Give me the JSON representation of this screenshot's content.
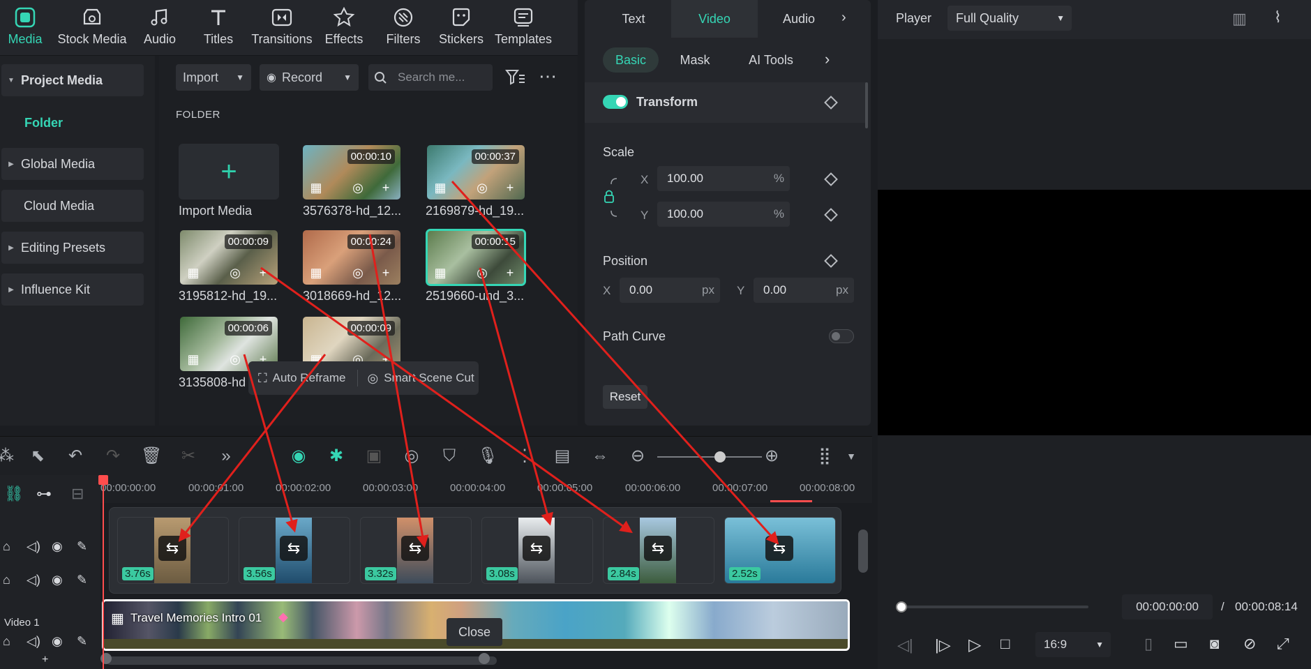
{
  "toolbar": {
    "items": [
      {
        "label": "Media",
        "icon": "media-icon"
      },
      {
        "label": "Stock Media",
        "icon": "stock-media-icon"
      },
      {
        "label": "Audio",
        "icon": "audio-icon"
      },
      {
        "label": "Titles",
        "icon": "titles-icon"
      },
      {
        "label": "Transitions",
        "icon": "transitions-icon"
      },
      {
        "label": "Effects",
        "icon": "effects-icon"
      },
      {
        "label": "Filters",
        "icon": "filters-icon"
      },
      {
        "label": "Stickers",
        "icon": "stickers-icon"
      },
      {
        "label": "Templates",
        "icon": "templates-icon"
      }
    ]
  },
  "sidebar": {
    "items": [
      "Project Media",
      "Global Media",
      "Cloud Media",
      "Editing Presets",
      "Influence Kit"
    ],
    "folder": "Folder"
  },
  "media": {
    "import_label": "Import",
    "record_label": "Record",
    "search_placeholder": "Search me...",
    "folder_header": "FOLDER",
    "import_media": "Import Media",
    "clips": [
      {
        "name": "3576378-hd_12...",
        "duration": "00:00:10"
      },
      {
        "name": "2169879-hd_19...",
        "duration": "00:00:37"
      },
      {
        "name": "3195812-hd_19...",
        "duration": "00:00:09"
      },
      {
        "name": "3018669-hd_12...",
        "duration": "00:00:24"
      },
      {
        "name": "2519660-uhd_3...",
        "duration": "00:00:15"
      },
      {
        "name": "3135808-hd",
        "duration": "00:00:06"
      },
      {
        "name": "",
        "duration": "00:00:09"
      }
    ],
    "popup": {
      "auto_reframe": "Auto Reframe",
      "smart_scene_cut": "Smart Scene Cut"
    }
  },
  "panel": {
    "tabs": [
      "Text",
      "Video",
      "Audio"
    ],
    "subtabs": [
      "Basic",
      "Mask",
      "AI Tools"
    ],
    "transform": "Transform",
    "scale": "Scale",
    "scale_x": "100.00",
    "scale_y": "100.00",
    "percent": "%",
    "position": "Position",
    "pos_x": "0.00",
    "pos_y": "0.00",
    "px": "px",
    "path_curve": "Path Curve",
    "reset": "Reset",
    "x_label": "X",
    "y_label": "Y"
  },
  "player": {
    "label": "Player",
    "quality": "Full Quality",
    "current_time": "00:00:00:00",
    "separator": "/",
    "total_time": "00:00:08:14",
    "aspect": "16:9"
  },
  "timeline": {
    "ticks": [
      "00:00:00:00",
      "00:00:01:00",
      "00:00:02:00",
      "00:00:03:00",
      "00:00:04:00",
      "00:00:05:00",
      "00:00:06:00",
      "00:00:07:00",
      "00:00:08:00"
    ],
    "clip_lengths": [
      "3.76s",
      "3.56s",
      "3.32s",
      "3.08s",
      "2.84s",
      "2.52s"
    ],
    "main_clip_title": "Travel Memories Intro 01",
    "track_label": "Video 1",
    "close": "Close"
  },
  "colors": {
    "accent": "#35d6b5",
    "arrow": "#e0201c",
    "playhead": "#ff4d4d"
  }
}
